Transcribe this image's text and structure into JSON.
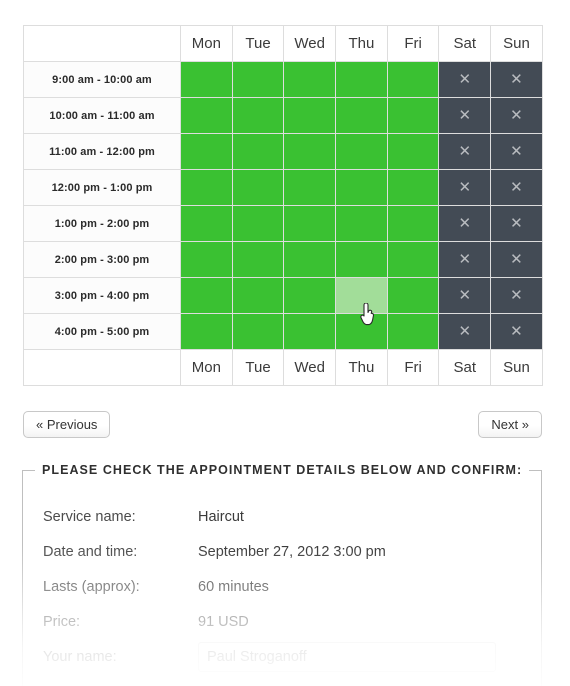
{
  "schedule": {
    "days": [
      "Mon",
      "Tue",
      "Wed",
      "Thu",
      "Fri",
      "Sat",
      "Sun"
    ],
    "closed_mark": "✕",
    "colors": {
      "available": "#3ac132",
      "hovered": "#a2dd99",
      "closed": "#434b55",
      "closed_mark": "#b8bbbf",
      "grid": "#dddddd"
    },
    "rows": [
      {
        "time": "9:00 am - 10:00 am",
        "cells": [
          "open",
          "open",
          "open",
          "open",
          "open",
          "closed",
          "closed"
        ]
      },
      {
        "time": "10:00 am - 11:00 am",
        "cells": [
          "open",
          "open",
          "open",
          "open",
          "open",
          "closed",
          "closed"
        ]
      },
      {
        "time": "11:00 am - 12:00 pm",
        "cells": [
          "open",
          "open",
          "open",
          "open",
          "open",
          "closed",
          "closed"
        ]
      },
      {
        "time": "12:00 pm - 1:00 pm",
        "cells": [
          "open",
          "open",
          "open",
          "open",
          "open",
          "closed",
          "closed"
        ]
      },
      {
        "time": "1:00 pm - 2:00 pm",
        "cells": [
          "open",
          "open",
          "open",
          "open",
          "open",
          "closed",
          "closed"
        ]
      },
      {
        "time": "2:00 pm - 3:00 pm",
        "cells": [
          "open",
          "open",
          "open",
          "open",
          "open",
          "closed",
          "closed"
        ]
      },
      {
        "time": "3:00 pm - 4:00 pm",
        "cells": [
          "open",
          "open",
          "open",
          "hover",
          "open",
          "closed",
          "closed"
        ]
      },
      {
        "time": "4:00 pm - 5:00 pm",
        "cells": [
          "open",
          "open",
          "open",
          "open",
          "open",
          "closed",
          "closed"
        ]
      }
    ]
  },
  "nav": {
    "previous_label": "« Previous",
    "next_label": "Next »"
  },
  "details": {
    "legend": "PLEASE CHECK THE APPOINTMENT DETAILS BELOW AND CONFIRM:",
    "rows": [
      {
        "label": "Service name:",
        "value": "Haircut"
      },
      {
        "label": "Date and time:",
        "value": "September 27, 2012 3:00 pm"
      },
      {
        "label": "Lasts (approx):",
        "value": "60 minutes"
      },
      {
        "label": "Price:",
        "value": "91 USD"
      }
    ],
    "name_field": {
      "label": "Your name:",
      "value": "",
      "placeholder": "Paul Stroganoff"
    }
  }
}
